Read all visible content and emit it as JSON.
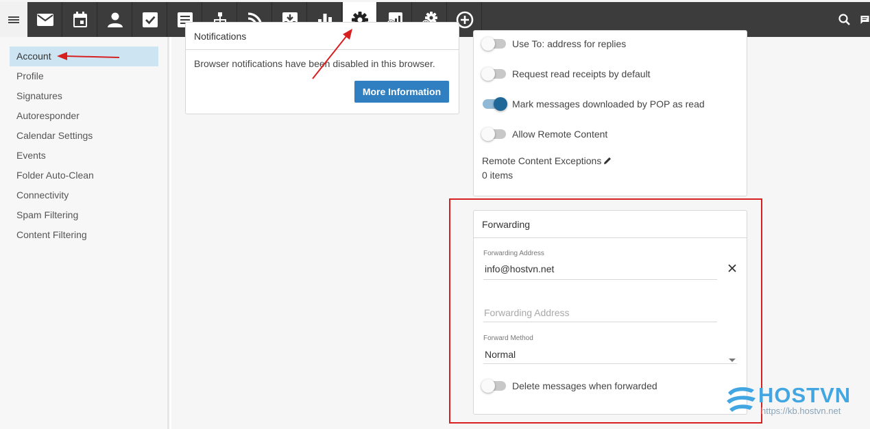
{
  "toolbar": {
    "icons": [
      "menu-icon",
      "mail-icon",
      "calendar-icon",
      "contacts-icon",
      "tasks-icon",
      "notes-icon",
      "sitemap-icon",
      "rss-icon",
      "archive-icon",
      "reports-icon",
      "settings-icon",
      "domain-reports-icon",
      "domain-settings-icon",
      "add-icon"
    ],
    "active": "settings-icon",
    "right_icons": [
      "search-icon",
      "chat-icon"
    ]
  },
  "sidebar": {
    "items": [
      {
        "label": "Account",
        "active": true
      },
      {
        "label": "Profile"
      },
      {
        "label": "Signatures"
      },
      {
        "label": "Autoresponder"
      },
      {
        "label": "Calendar Settings"
      },
      {
        "label": "Events"
      },
      {
        "label": "Folder Auto-Clean"
      },
      {
        "label": "Connectivity"
      },
      {
        "label": "Spam Filtering"
      },
      {
        "label": "Content Filtering"
      }
    ]
  },
  "notifications": {
    "title": "Notifications",
    "message": "Browser notifications have been disabled in this browser.",
    "button": "More Information"
  },
  "options": {
    "use_to_address": {
      "label": "Use To: address for replies",
      "on": false
    },
    "read_receipts": {
      "label": "Request read receipts by default",
      "on": false
    },
    "pop_read": {
      "label": "Mark messages downloaded by POP as read",
      "on": true
    },
    "remote_content": {
      "label": "Allow Remote Content",
      "on": false
    },
    "exceptions_label": "Remote Content Exceptions",
    "exceptions_count": "0 items"
  },
  "forwarding": {
    "title": "Forwarding",
    "address_label": "Forwarding Address",
    "address_value": "info@hostvn.net",
    "address_placeholder": "Forwarding Address",
    "method_label": "Forward Method",
    "method_value": "Normal",
    "delete_label": "Delete messages when forwarded",
    "delete_on": false
  },
  "watermark": {
    "brand": "HOSTVN",
    "url": "https://kb.hostvn.net"
  },
  "colors": {
    "topbar": "#3c3c3c",
    "accent": "#2f7fc1",
    "highlight": "#cde5f3",
    "annotation": "#d81f1f"
  }
}
